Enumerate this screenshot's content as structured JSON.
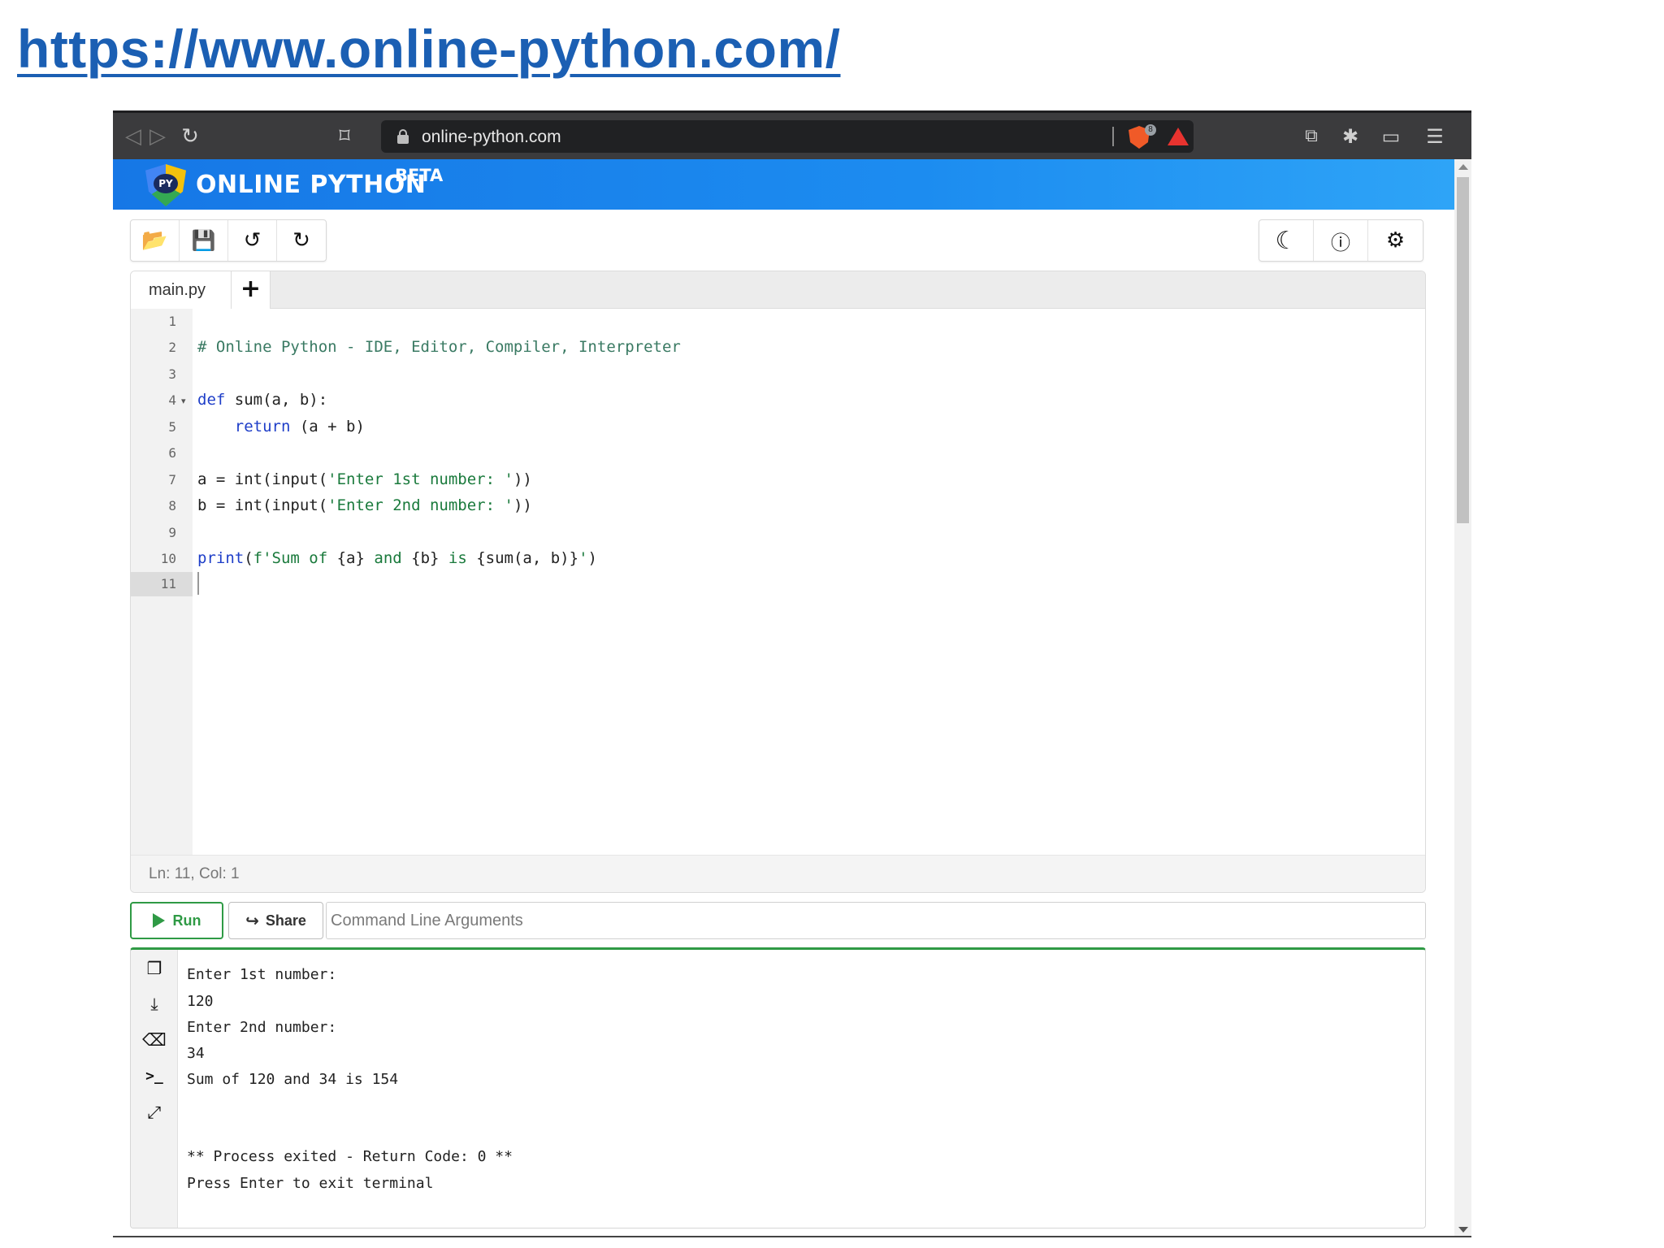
{
  "heading_link": "https://www.online-python.com/",
  "browser": {
    "url": "online-python.com",
    "nav_icons": [
      "back-icon",
      "forward-icon",
      "reload-icon",
      "bookmark-icon"
    ],
    "ext_icons": [
      "brave-shields-icon",
      "brave-rewards-icon",
      "tab-manager-icon",
      "extensions-icon",
      "wallet-icon",
      "menu-icon"
    ],
    "brave_badge": "8"
  },
  "site": {
    "logo_text": "PY",
    "title": "ONLINE PYTHON",
    "beta": "BETA",
    "colors": {
      "header_start": "#1677e6",
      "header_end": "#2ea4f7",
      "run_green": "#2f9a45"
    }
  },
  "toolbar": {
    "left": [
      "open-folder-icon",
      "save-icon",
      "undo-icon",
      "redo-icon"
    ],
    "right": [
      "moon-icon",
      "info-icon",
      "settings-icon"
    ]
  },
  "editor": {
    "tab_name": "main.py",
    "add_tab": "+",
    "line_numbers": [
      "1",
      "2",
      "3",
      "4",
      "5",
      "6",
      "7",
      "8",
      "9",
      "10",
      "11"
    ],
    "code": {
      "l2": "# Online Python - IDE, Editor, Compiler, Interpreter",
      "l4_kw": "def",
      "l4_rest": " sum(a, b):",
      "l5_indent": "    ",
      "l5_kw": "return",
      "l5_rest": " (a + b)",
      "l7_a": "a = int(input(",
      "l7_str": "'Enter 1st number: '",
      "l7_b": "))",
      "l8_a": "b = int(input(",
      "l8_str": "'Enter 2nd number: '",
      "l8_b": "))",
      "l10_kw": "print",
      "l10_a": "(",
      "l10_str1": "f'Sum of ",
      "l10_b": "{a}",
      "l10_str2": " and ",
      "l10_c": "{b}",
      "l10_str3": " is ",
      "l10_d": "{sum(a, b)}",
      "l10_str4": "'",
      "l10_e": ")"
    },
    "status": "Ln: 11,  Col: 1"
  },
  "runbar": {
    "run_label": "Run",
    "share_label": "Share",
    "args_placeholder": "Command Line Arguments"
  },
  "terminal": {
    "icons": [
      "copy-icon",
      "download-icon",
      "eraser-icon",
      "terminal-icon",
      "expand-icon"
    ],
    "lines": [
      "Enter 1st number:",
      "120",
      "Enter 2nd number:",
      "34",
      "Sum of 120 and 34 is 154",
      "** Process exited - Return Code: 0 **",
      "Press Enter to exit terminal"
    ]
  }
}
